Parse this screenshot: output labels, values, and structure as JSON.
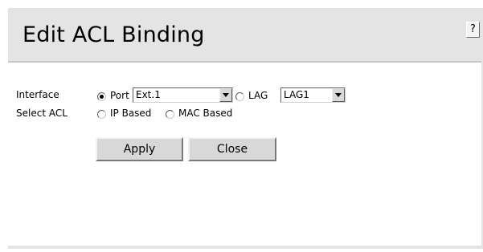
{
  "dialog": {
    "title": "Edit ACL Binding",
    "help_label": "?"
  },
  "form": {
    "interface_label": "Interface",
    "port_option_label": "Port",
    "port_selected": "Ext.1",
    "lag_option_label": "LAG",
    "lag_selected": "LAG1",
    "interface_choice": "Port",
    "select_acl_label": "Select ACL",
    "ip_based_label": "IP Based",
    "mac_based_label": "MAC Based"
  },
  "buttons": {
    "apply_label": "Apply",
    "close_label": "Close"
  },
  "icons": {
    "help": "help-icon",
    "dropdown": "chevron-down-icon"
  },
  "colors": {
    "panel_gray": "#e4e4e4",
    "content_bg": "#ffffff",
    "button_face": "#d8d8d8"
  }
}
